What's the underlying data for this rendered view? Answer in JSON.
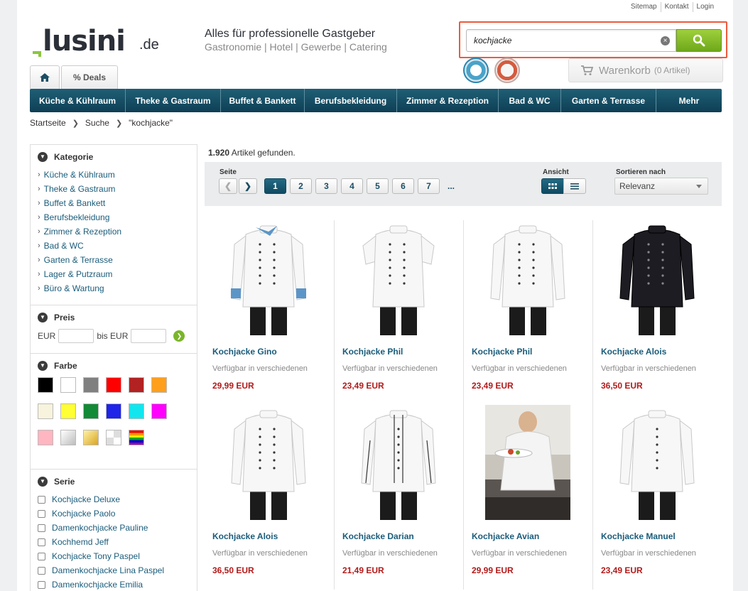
{
  "toplinks": [
    "Sitemap",
    "Kontakt",
    "Login"
  ],
  "logo": {
    "name": "lusini",
    "tld": ".de"
  },
  "tagline": {
    "title": "Alles für professionelle Gastgeber",
    "subtitle": "Gastronomie | Hotel | Gewerbe | Catering"
  },
  "search": {
    "value": "kochjacke",
    "clear_icon": "×"
  },
  "cart": {
    "label": "Warenkorb",
    "count": "(0 Artikel)"
  },
  "tabs": {
    "home_icon": "home-icon",
    "deals": "% Deals"
  },
  "nav": [
    "Küche & Kühlraum",
    "Theke & Gastraum",
    "Buffet & Bankett",
    "Berufsbekleidung",
    "Zimmer & Rezeption",
    "Bad & WC",
    "Garten & Terrasse",
    "Mehr"
  ],
  "breadcrumb": [
    "Startseite",
    "Suche",
    "\"kochjacke\""
  ],
  "sidebar": {
    "kategorie_title": "Kategorie",
    "kategorien": [
      "Küche & Kühlraum",
      "Theke & Gastraum",
      "Buffet & Bankett",
      "Berufsbekleidung",
      "Zimmer & Rezeption",
      "Bad & WC",
      "Garten & Terrasse",
      "Lager & Putzraum",
      "Büro & Wartung"
    ],
    "preis_title": "Preis",
    "preis_from": "EUR",
    "preis_to": "bis EUR",
    "farbe_title": "Farbe",
    "farben": [
      "#000000",
      "#ffffff",
      "#808080",
      "#ff0000",
      "#b22222",
      "#ff9f1c",
      "#f7f3dc",
      "#ffff33",
      "#138a36",
      "#1f24e8",
      "#11e6ee",
      "#ff00ff",
      "#ffb6c1",
      "silver",
      "gold",
      "check",
      "multi"
    ],
    "serie_title": "Serie",
    "serien": [
      "Kochjacke Deluxe",
      "Kochjacke Paolo",
      "Damenkochjacke Pauline",
      "Kochhemd Jeff",
      "Kochjacke Tony Paspel",
      "Damenkochjacke Lina Paspel",
      "Damenkochjacke Emilia"
    ]
  },
  "results": {
    "count": "1.920",
    "count_suffix": "Artikel gefunden.",
    "seite_label": "Seite",
    "pages": [
      "1",
      "2",
      "3",
      "4",
      "5",
      "6",
      "7"
    ],
    "current_page": "1",
    "dots": "...",
    "ansicht_label": "Ansicht",
    "sort_label": "Sortieren nach",
    "sort_value": "Relevanz"
  },
  "products": [
    {
      "title": "Kochjacke Gino",
      "avail": "Verfügbar in verschiedenen",
      "price": "29,99 EUR",
      "style": "gino"
    },
    {
      "title": "Kochjacke Phil",
      "avail": "Verfügbar in verschiedenen",
      "price": "23,49 EUR",
      "style": "short"
    },
    {
      "title": "Kochjacke Phil",
      "avail": "Verfügbar in verschiedenen",
      "price": "23,49 EUR",
      "style": "long"
    },
    {
      "title": "Kochjacke Alois",
      "avail": "Verfügbar in verschiedenen",
      "price": "36,50 EUR",
      "style": "black"
    },
    {
      "title": "Kochjacke Alois",
      "avail": "Verfügbar in verschiedenen",
      "price": "36,50 EUR",
      "style": "long"
    },
    {
      "title": "Kochjacke Darian",
      "avail": "Verfügbar in verschiedenen",
      "price": "21,49 EUR",
      "style": "darian"
    },
    {
      "title": "Kochjacke Avian",
      "avail": "Verfügbar in verschiedenen",
      "price": "29,99 EUR",
      "style": "photo"
    },
    {
      "title": "Kochjacke Manuel",
      "avail": "Verfügbar in verschiedenen",
      "price": "23,49 EUR",
      "style": "manuel"
    }
  ],
  "colors": {
    "nav": "#0e3f55",
    "link": "#1a5c7a",
    "price": "#b21a1a",
    "search_btn": "#7bb52b",
    "highlight": "#ef5a3c"
  }
}
